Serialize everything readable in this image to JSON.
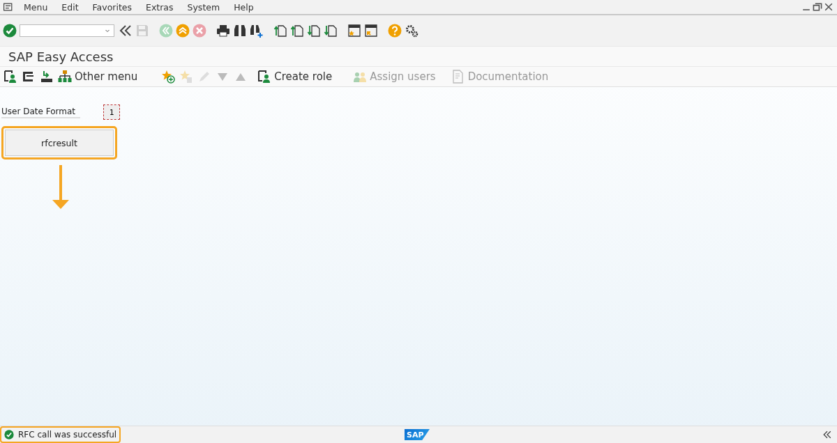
{
  "menu_bar": {
    "items": [
      "Menu",
      "Edit",
      "Favorites",
      "Extras",
      "System",
      "Help"
    ]
  },
  "title": "SAP Easy Access",
  "app_toolbar": {
    "items": [
      {
        "label": "Other menu",
        "disabled": false
      },
      {
        "label": "Create role",
        "disabled": false
      },
      {
        "label": "Assign users",
        "disabled": true
      },
      {
        "label": "Documentation",
        "disabled": true
      }
    ]
  },
  "form": {
    "label": "User Date Format",
    "value": "1",
    "button": "rfcresult"
  },
  "status_bar": {
    "message": "RFC call was successful",
    "logo": "SAP"
  }
}
